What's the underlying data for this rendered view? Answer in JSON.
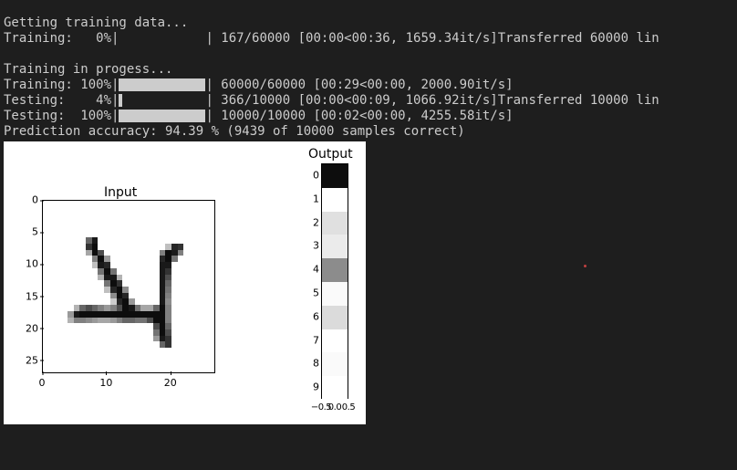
{
  "terminal": {
    "line0": "Getting training data...",
    "line1_prefix": "Training:   0%|",
    "line1_suffix": "| 167/60000 [00:00<00:36, 1659.34it/s]Transferred 60000 lin",
    "line2": "",
    "line3": "Training in progess...",
    "line4_prefix": "Training: 100%|",
    "line4_suffix": "| 60000/60000 [00:29<00:00, 2000.90it/s]",
    "line5_prefix": "Testing:    4%|",
    "line5_suffix": "| 366/10000 [00:00<00:09, 1066.92it/s]Transferred 10000 lin",
    "line6_prefix": "Testing:  100%|",
    "line6_suffix": "| 10000/10000 [00:02<00:00, 4255.58it/s]",
    "line7": "Prediction accuracy: 94.39 % (9439 of 10000 samples correct)"
  },
  "progress_pct": {
    "line1": 0,
    "line4": 100,
    "line5": 4,
    "line6": 100
  },
  "plot": {
    "input_title": "Input",
    "output_title": "Output",
    "yticks": [
      0,
      5,
      10,
      15,
      20,
      25
    ],
    "xticks": [
      0,
      10,
      20
    ],
    "out_labels": [
      0,
      1,
      2,
      3,
      4,
      5,
      6,
      7,
      8,
      9
    ],
    "out_xticks": [
      "−0.5",
      "0.0",
      "0.5"
    ]
  },
  "chart_data": [
    {
      "type": "heatmap",
      "title": "Input",
      "xlim": [
        0,
        27
      ],
      "ylim": [
        0,
        27
      ],
      "description": "28x28 grayscale MNIST digit image depicting the digit 4",
      "digit": 4,
      "pixels_nonwhite": [
        [
          6,
          7,
          0.6
        ],
        [
          6,
          8,
          0.9
        ],
        [
          7,
          7,
          0.8
        ],
        [
          7,
          8,
          0.95
        ],
        [
          7,
          20,
          0.25
        ],
        [
          7,
          21,
          0.85
        ],
        [
          7,
          22,
          0.8
        ],
        [
          8,
          7,
          0.35
        ],
        [
          8,
          8,
          0.95
        ],
        [
          8,
          9,
          0.7
        ],
        [
          8,
          19,
          0.5
        ],
        [
          8,
          20,
          0.95
        ],
        [
          8,
          21,
          0.9
        ],
        [
          8,
          22,
          0.5
        ],
        [
          9,
          8,
          0.5
        ],
        [
          9,
          9,
          0.95
        ],
        [
          9,
          10,
          0.4
        ],
        [
          9,
          19,
          0.85
        ],
        [
          9,
          20,
          0.95
        ],
        [
          9,
          21,
          0.55
        ],
        [
          10,
          8,
          0.25
        ],
        [
          10,
          9,
          0.9
        ],
        [
          10,
          10,
          0.85
        ],
        [
          10,
          19,
          0.9
        ],
        [
          10,
          20,
          0.9
        ],
        [
          11,
          9,
          0.55
        ],
        [
          11,
          10,
          0.95
        ],
        [
          11,
          11,
          0.55
        ],
        [
          11,
          19,
          0.9
        ],
        [
          11,
          20,
          0.8
        ],
        [
          12,
          9,
          0.3
        ],
        [
          12,
          10,
          0.9
        ],
        [
          12,
          11,
          0.9
        ],
        [
          12,
          12,
          0.3
        ],
        [
          12,
          19,
          0.9
        ],
        [
          12,
          20,
          0.7
        ],
        [
          13,
          10,
          0.55
        ],
        [
          13,
          11,
          0.95
        ],
        [
          13,
          12,
          0.8
        ],
        [
          13,
          19,
          0.9
        ],
        [
          13,
          20,
          0.6
        ],
        [
          14,
          10,
          0.25
        ],
        [
          14,
          11,
          0.85
        ],
        [
          14,
          12,
          0.95
        ],
        [
          14,
          13,
          0.45
        ],
        [
          14,
          19,
          0.9
        ],
        [
          14,
          20,
          0.55
        ],
        [
          15,
          11,
          0.45
        ],
        [
          15,
          12,
          0.95
        ],
        [
          15,
          13,
          0.85
        ],
        [
          15,
          19,
          0.9
        ],
        [
          15,
          20,
          0.5
        ],
        [
          16,
          11,
          0.2
        ],
        [
          16,
          12,
          0.85
        ],
        [
          16,
          13,
          0.95
        ],
        [
          16,
          14,
          0.4
        ],
        [
          16,
          19,
          0.9
        ],
        [
          16,
          20,
          0.45
        ],
        [
          17,
          5,
          0.3
        ],
        [
          17,
          6,
          0.6
        ],
        [
          17,
          7,
          0.7
        ],
        [
          17,
          8,
          0.6
        ],
        [
          17,
          9,
          0.5
        ],
        [
          17,
          10,
          0.4
        ],
        [
          17,
          11,
          0.5
        ],
        [
          17,
          12,
          0.7
        ],
        [
          17,
          13,
          0.95
        ],
        [
          17,
          14,
          0.9
        ],
        [
          17,
          15,
          0.55
        ],
        [
          17,
          16,
          0.35
        ],
        [
          17,
          17,
          0.35
        ],
        [
          17,
          18,
          0.6
        ],
        [
          17,
          19,
          0.95
        ],
        [
          17,
          20,
          0.5
        ],
        [
          18,
          4,
          0.4
        ],
        [
          18,
          5,
          0.9
        ],
        [
          18,
          6,
          0.95
        ],
        [
          18,
          7,
          0.95
        ],
        [
          18,
          8,
          0.95
        ],
        [
          18,
          9,
          0.95
        ],
        [
          18,
          10,
          0.95
        ],
        [
          18,
          11,
          0.95
        ],
        [
          18,
          12,
          0.95
        ],
        [
          18,
          13,
          0.95
        ],
        [
          18,
          14,
          0.95
        ],
        [
          18,
          15,
          0.95
        ],
        [
          18,
          16,
          0.95
        ],
        [
          18,
          17,
          0.95
        ],
        [
          18,
          18,
          0.95
        ],
        [
          18,
          19,
          0.95
        ],
        [
          18,
          20,
          0.5
        ],
        [
          19,
          4,
          0.3
        ],
        [
          19,
          5,
          0.5
        ],
        [
          19,
          6,
          0.5
        ],
        [
          19,
          7,
          0.45
        ],
        [
          19,
          8,
          0.4
        ],
        [
          19,
          9,
          0.35
        ],
        [
          19,
          10,
          0.35
        ],
        [
          19,
          11,
          0.4
        ],
        [
          19,
          12,
          0.5
        ],
        [
          19,
          13,
          0.6
        ],
        [
          19,
          14,
          0.6
        ],
        [
          19,
          15,
          0.55
        ],
        [
          19,
          16,
          0.55
        ],
        [
          19,
          17,
          0.7
        ],
        [
          19,
          18,
          0.95
        ],
        [
          19,
          19,
          0.95
        ],
        [
          19,
          20,
          0.5
        ],
        [
          20,
          18,
          0.7
        ],
        [
          20,
          19,
          0.95
        ],
        [
          20,
          20,
          0.6
        ],
        [
          21,
          18,
          0.55
        ],
        [
          21,
          19,
          0.95
        ],
        [
          21,
          20,
          0.7
        ],
        [
          22,
          18,
          0.4
        ],
        [
          22,
          19,
          0.9
        ],
        [
          22,
          20,
          0.8
        ],
        [
          23,
          19,
          0.6
        ],
        [
          23,
          20,
          0.8
        ]
      ]
    },
    {
      "type": "heatmap",
      "title": "Output",
      "categories": [
        0,
        1,
        2,
        3,
        4,
        5,
        6,
        7,
        8,
        9
      ],
      "xlim": [
        -0.5,
        0.5
      ],
      "values_intensity": [
        0.95,
        0.0,
        0.12,
        0.08,
        0.45,
        0.02,
        0.14,
        0.0,
        0.02,
        0.0
      ],
      "predicted_class": 4
    }
  ]
}
